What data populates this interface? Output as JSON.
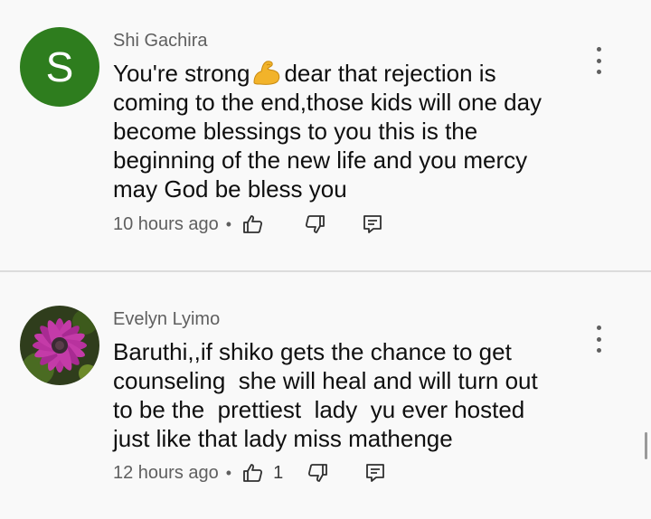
{
  "comments": [
    {
      "author": "Shi Gachira",
      "avatar_letter": "S",
      "avatar_color": "#2e7d1e",
      "text_lines": [
        "You're strong",
        "dear that rejection is",
        "coming to the end,those kids will one day",
        "become blessings to you this is the",
        "beginning of the new life and you mercy",
        "may God be bless you"
      ],
      "emoji": "flexed-biceps-emoji",
      "time": "10 hours ago",
      "separator": "•",
      "like_count": ""
    },
    {
      "author": "Evelyn Lyimo",
      "avatar_image": "purple-daisy-flower",
      "text_lines": [
        "Baruthi,,if shiko gets the chance to get",
        "counseling  she will heal and will turn out",
        "to be the  prettiest  lady  yu ever hosted",
        "just like that lady miss mathenge"
      ],
      "time": "12 hours ago",
      "separator": "•",
      "like_count": "1"
    }
  ],
  "icons": {
    "like": "thumbs-up-icon",
    "dislike": "thumbs-down-icon",
    "reply": "reply-comment-icon",
    "more": "more-vertical-icon"
  }
}
